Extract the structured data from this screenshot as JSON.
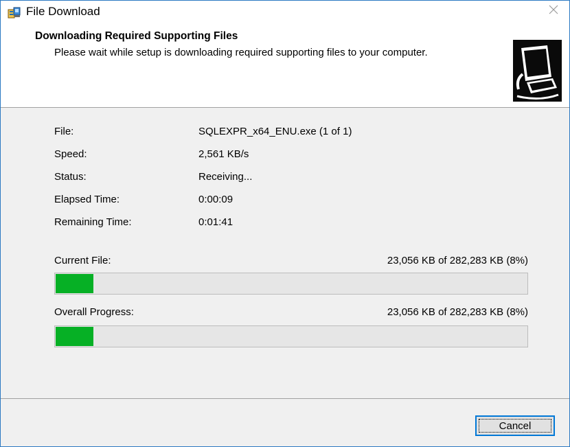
{
  "window": {
    "title": "File Download"
  },
  "header": {
    "title": "Downloading Required Supporting Files",
    "description": "Please wait while setup is downloading required supporting files to your computer."
  },
  "info": {
    "file_label": "File:",
    "file_value": "SQLEXPR_x64_ENU.exe (1 of 1)",
    "speed_label": "Speed:",
    "speed_value": "2,561 KB/s",
    "status_label": "Status:",
    "status_value": "Receiving...",
    "elapsed_label": "Elapsed Time:",
    "elapsed_value": "0:00:09",
    "remaining_label": "Remaining Time:",
    "remaining_value": "0:01:41"
  },
  "current_file": {
    "label": "Current File:",
    "amount": "23,056 KB of 282,283 KB (8%)",
    "progress": 0.08
  },
  "overall": {
    "label": "Overall Progress:",
    "amount": "23,056 KB of 282,283 KB (8%)",
    "progress": 0.08
  },
  "buttons": {
    "cancel": "Cancel"
  },
  "icons": {
    "window_icon": "setup-installer-icon",
    "close": "close-icon",
    "header_art": "computer-download-icon"
  },
  "colors": {
    "progress_fill": "#06b025",
    "window_border": "#2b79c2",
    "button_focus": "#0078d7"
  }
}
